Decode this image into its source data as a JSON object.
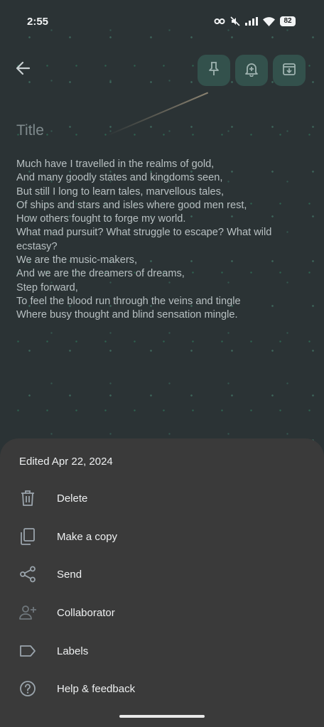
{
  "status_bar": {
    "time": "2:55",
    "battery": "82"
  },
  "toolbar": {
    "back_icon": "arrow-left-icon",
    "pin_icon": "pin-icon",
    "reminder_icon": "bell-plus-icon",
    "archive_icon": "archive-icon",
    "accent_color": "#33514c"
  },
  "note": {
    "title_placeholder": "Title",
    "lines": [
      "Much have I travelled in the realms of gold,",
      "And many goodly states and kingdoms seen,",
      "But still I long to learn tales, marvellous tales,",
      "Of ships and stars and isles where good men rest,",
      "How others fought to forge my world.",
      "What mad pursuit? What struggle to escape? What wild",
      "ecstasy?",
      "We are the music-makers,",
      "And we are the dreamers of dreams,",
      "Step forward,",
      "To feel the blood run through the veins and tingle",
      "Where busy thought and blind sensation mingle."
    ]
  },
  "sheet": {
    "edited": "Edited Apr 22, 2024",
    "items": [
      {
        "label": "Delete",
        "icon": "trash-icon"
      },
      {
        "label": "Make a copy",
        "icon": "copy-icon"
      },
      {
        "label": "Send",
        "icon": "share-icon"
      },
      {
        "label": "Collaborator",
        "icon": "person-add-icon"
      },
      {
        "label": "Labels",
        "icon": "label-icon"
      },
      {
        "label": "Help & feedback",
        "icon": "help-icon"
      }
    ]
  }
}
